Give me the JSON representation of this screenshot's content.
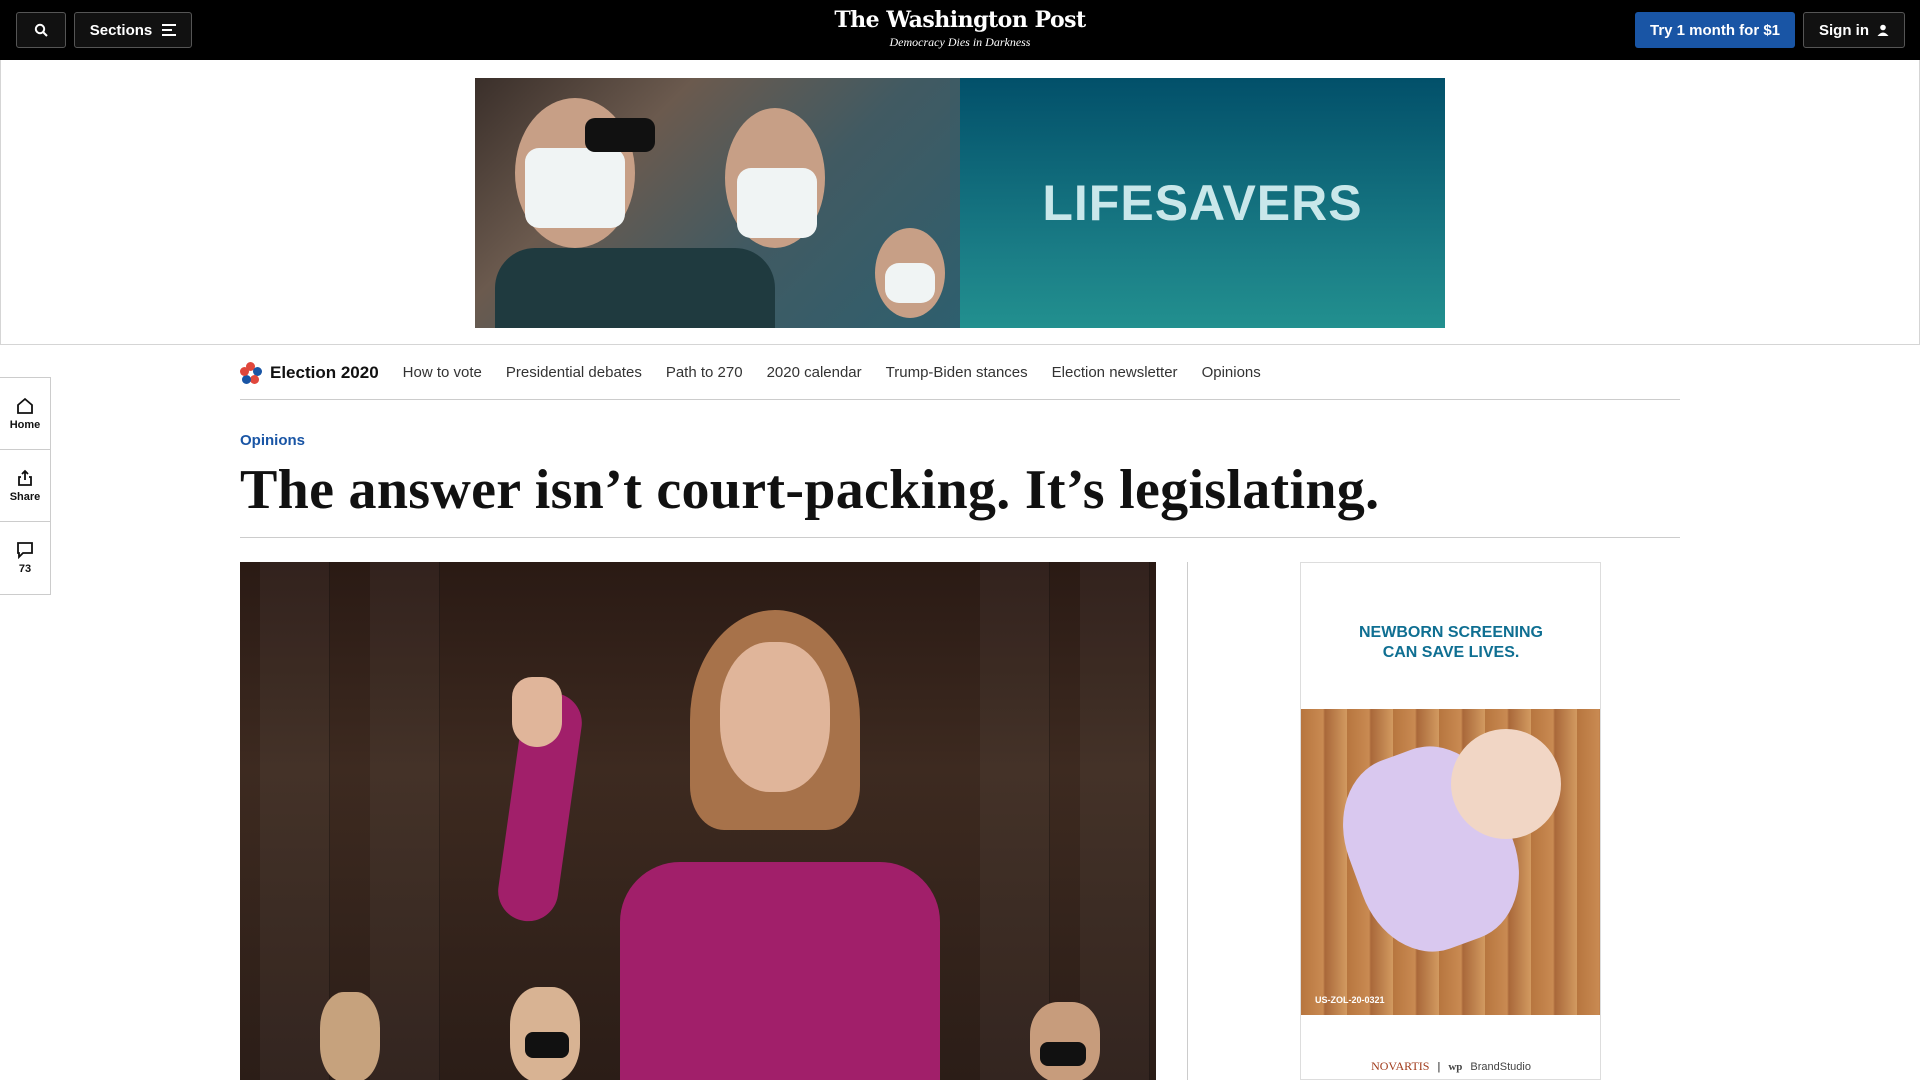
{
  "header": {
    "sections_label": "Sections",
    "logo": "The Washington Post",
    "tagline": "Democracy Dies in Darkness",
    "subscribe_label": "Try 1 month for $1",
    "signin_label": "Sign in"
  },
  "ad_banner": {
    "text": "LIFESAVERS"
  },
  "election_nav": {
    "title": "Election 2020",
    "items": [
      "How to vote",
      "Presidential debates",
      "Path to 270",
      "2020 calendar",
      "Trump-Biden stances",
      "Election newsletter",
      "Opinions"
    ]
  },
  "rail": {
    "home_label": "Home",
    "share_label": "Share",
    "comments_count": "73"
  },
  "article": {
    "kicker": "Opinions",
    "headline": "The answer isn’t court-packing. It’s legislating."
  },
  "side_ad": {
    "headline_line1": "NEWBORN SCREENING",
    "headline_line2": "CAN SAVE LIVES.",
    "code": "US-ZOL-20-0321",
    "sponsor": "NOVARTIS",
    "brand": "BrandStudio"
  },
  "colors": {
    "topbar": "#000000",
    "accent_blue": "#1955a5",
    "ad_teal": "#02506a"
  }
}
